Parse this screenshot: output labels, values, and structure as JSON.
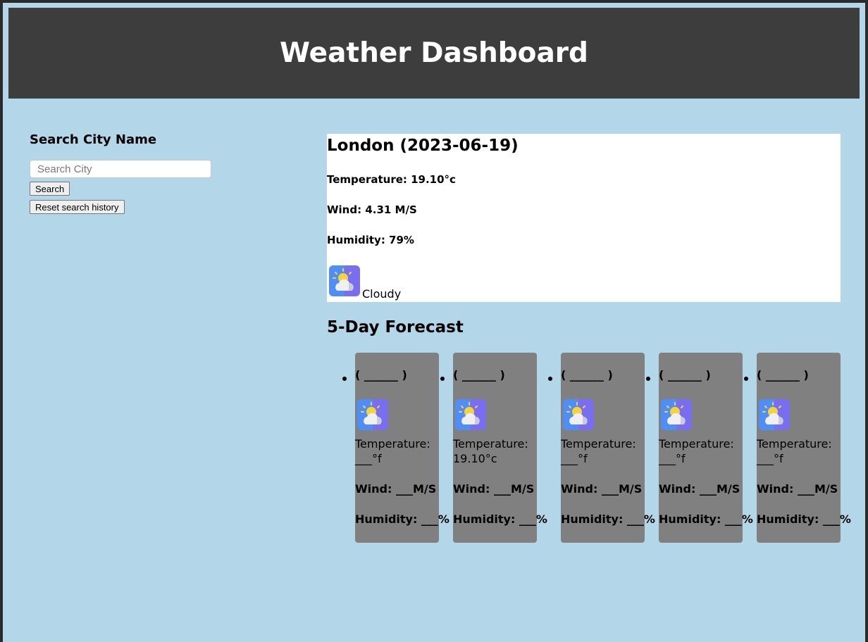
{
  "header": {
    "title": "Weather Dashboard"
  },
  "search": {
    "heading": "Search City Name",
    "placeholder": "Search City",
    "search_label": "Search",
    "reset_label": "Reset search history"
  },
  "current": {
    "title": "London (2023-06-19)",
    "temperature": "Temperature: 19.10°c",
    "wind": "Wind: 4.31 M/S",
    "humidity": "Humidity: 79%",
    "icon": "partly-cloudy-icon",
    "description": "Cloudy"
  },
  "forecast": {
    "title": "5-Day Forecast",
    "days": [
      {
        "date": "( ______ )",
        "icon": "partly-cloudy-icon",
        "temp": "Temperature: ___°f",
        "wind": "Wind: ___M/S",
        "humidity": "Humidity: ___%"
      },
      {
        "date": "( ______ )",
        "icon": "partly-cloudy-icon",
        "temp": "Temperature: 19.10°c",
        "wind": "Wind: ___M/S",
        "humidity": "Humidity: ___%"
      },
      {
        "date": "( ______ )",
        "icon": "partly-cloudy-icon",
        "temp": "Temperature: ___°f",
        "wind": "Wind: ___M/S",
        "humidity": "Humidity: ___%"
      },
      {
        "date": "( ______ )",
        "icon": "partly-cloudy-icon",
        "temp": "Temperature: ___°f",
        "wind": "Wind: ___M/S",
        "humidity": "Humidity: ___%"
      },
      {
        "date": "( ______ )",
        "icon": "partly-cloudy-icon",
        "temp": "Temperature: ___°f",
        "wind": "Wind: ___M/S",
        "humidity": "Humidity: ___%"
      }
    ]
  },
  "colors": {
    "page_bg": "#b3d6e8",
    "header_bg": "#3d3d3d",
    "card_bg": "#808080"
  }
}
